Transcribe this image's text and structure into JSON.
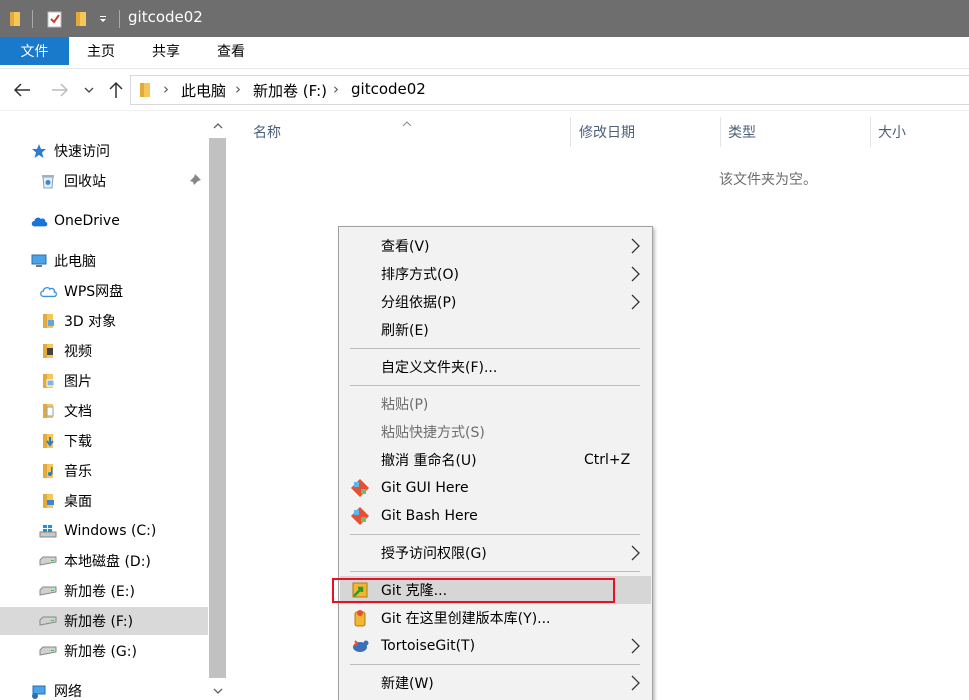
{
  "window": {
    "title": "gitcode02"
  },
  "ribbon": {
    "tabs": [
      "文件",
      "主页",
      "共享",
      "查看"
    ]
  },
  "address": {
    "crumbs": [
      "此电脑",
      "新加卷 (F:)",
      "gitcode02"
    ]
  },
  "sidebar": {
    "items": [
      {
        "label": "快速访问",
        "icon": "star-icon"
      },
      {
        "label": "回收站",
        "icon": "recycle-bin-icon",
        "pinned": true
      },
      {
        "label": "OneDrive",
        "icon": "cloud-icon"
      },
      {
        "label": "此电脑",
        "icon": "computer-icon"
      },
      {
        "label": "WPS网盘",
        "icon": "wps-cloud-icon"
      },
      {
        "label": "3D 对象",
        "icon": "cube-folder-icon"
      },
      {
        "label": "视频",
        "icon": "video-folder-icon"
      },
      {
        "label": "图片",
        "icon": "pictures-folder-icon"
      },
      {
        "label": "文档",
        "icon": "documents-folder-icon"
      },
      {
        "label": "下载",
        "icon": "downloads-folder-icon"
      },
      {
        "label": "音乐",
        "icon": "music-folder-icon"
      },
      {
        "label": "桌面",
        "icon": "desktop-folder-icon"
      },
      {
        "label": "Windows (C:)",
        "icon": "windows-drive-icon"
      },
      {
        "label": "本地磁盘 (D:)",
        "icon": "drive-icon"
      },
      {
        "label": "新加卷 (E:)",
        "icon": "drive-icon"
      },
      {
        "label": "新加卷 (F:)",
        "icon": "drive-icon",
        "selected": true
      },
      {
        "label": "新加卷 (G:)",
        "icon": "drive-icon"
      },
      {
        "label": "网络",
        "icon": "network-icon"
      }
    ]
  },
  "columns": [
    "名称",
    "修改日期",
    "类型",
    "大小"
  ],
  "empty_message": "该文件夹为空。",
  "context_menu": {
    "items": [
      {
        "label": "查看(V)",
        "submenu": true
      },
      {
        "label": "排序方式(O)",
        "submenu": true
      },
      {
        "label": "分组依据(P)",
        "submenu": true
      },
      {
        "label": "刷新(E)"
      },
      {
        "label": "自定义文件夹(F)..."
      },
      {
        "label": "粘贴(P)",
        "disabled": true
      },
      {
        "label": "粘贴快捷方式(S)",
        "disabled": true
      },
      {
        "label": "撤消 重命名(U)",
        "shortcut": "Ctrl+Z"
      },
      {
        "label": "Git GUI Here",
        "icon": "git-gui-icon"
      },
      {
        "label": "Git Bash Here",
        "icon": "git-bash-icon"
      },
      {
        "label": "授予访问权限(G)",
        "submenu": true
      },
      {
        "label": "Git 克隆...",
        "icon": "tortoisegit-clone-icon",
        "highlighted": true
      },
      {
        "label": "Git 在这里创建版本库(Y)...",
        "icon": "tortoisegit-create-repo-icon"
      },
      {
        "label": "TortoiseGit(T)",
        "icon": "tortoisegit-icon",
        "submenu": true
      },
      {
        "label": "新建(W)",
        "submenu": true
      }
    ]
  },
  "colors": {
    "title_bar": "#6e6e6e",
    "file_tab": "#1979ca",
    "menu_background": "#f2f2f2",
    "highlight_box": "#e81123",
    "selected_item": "#d9d9d9"
  }
}
